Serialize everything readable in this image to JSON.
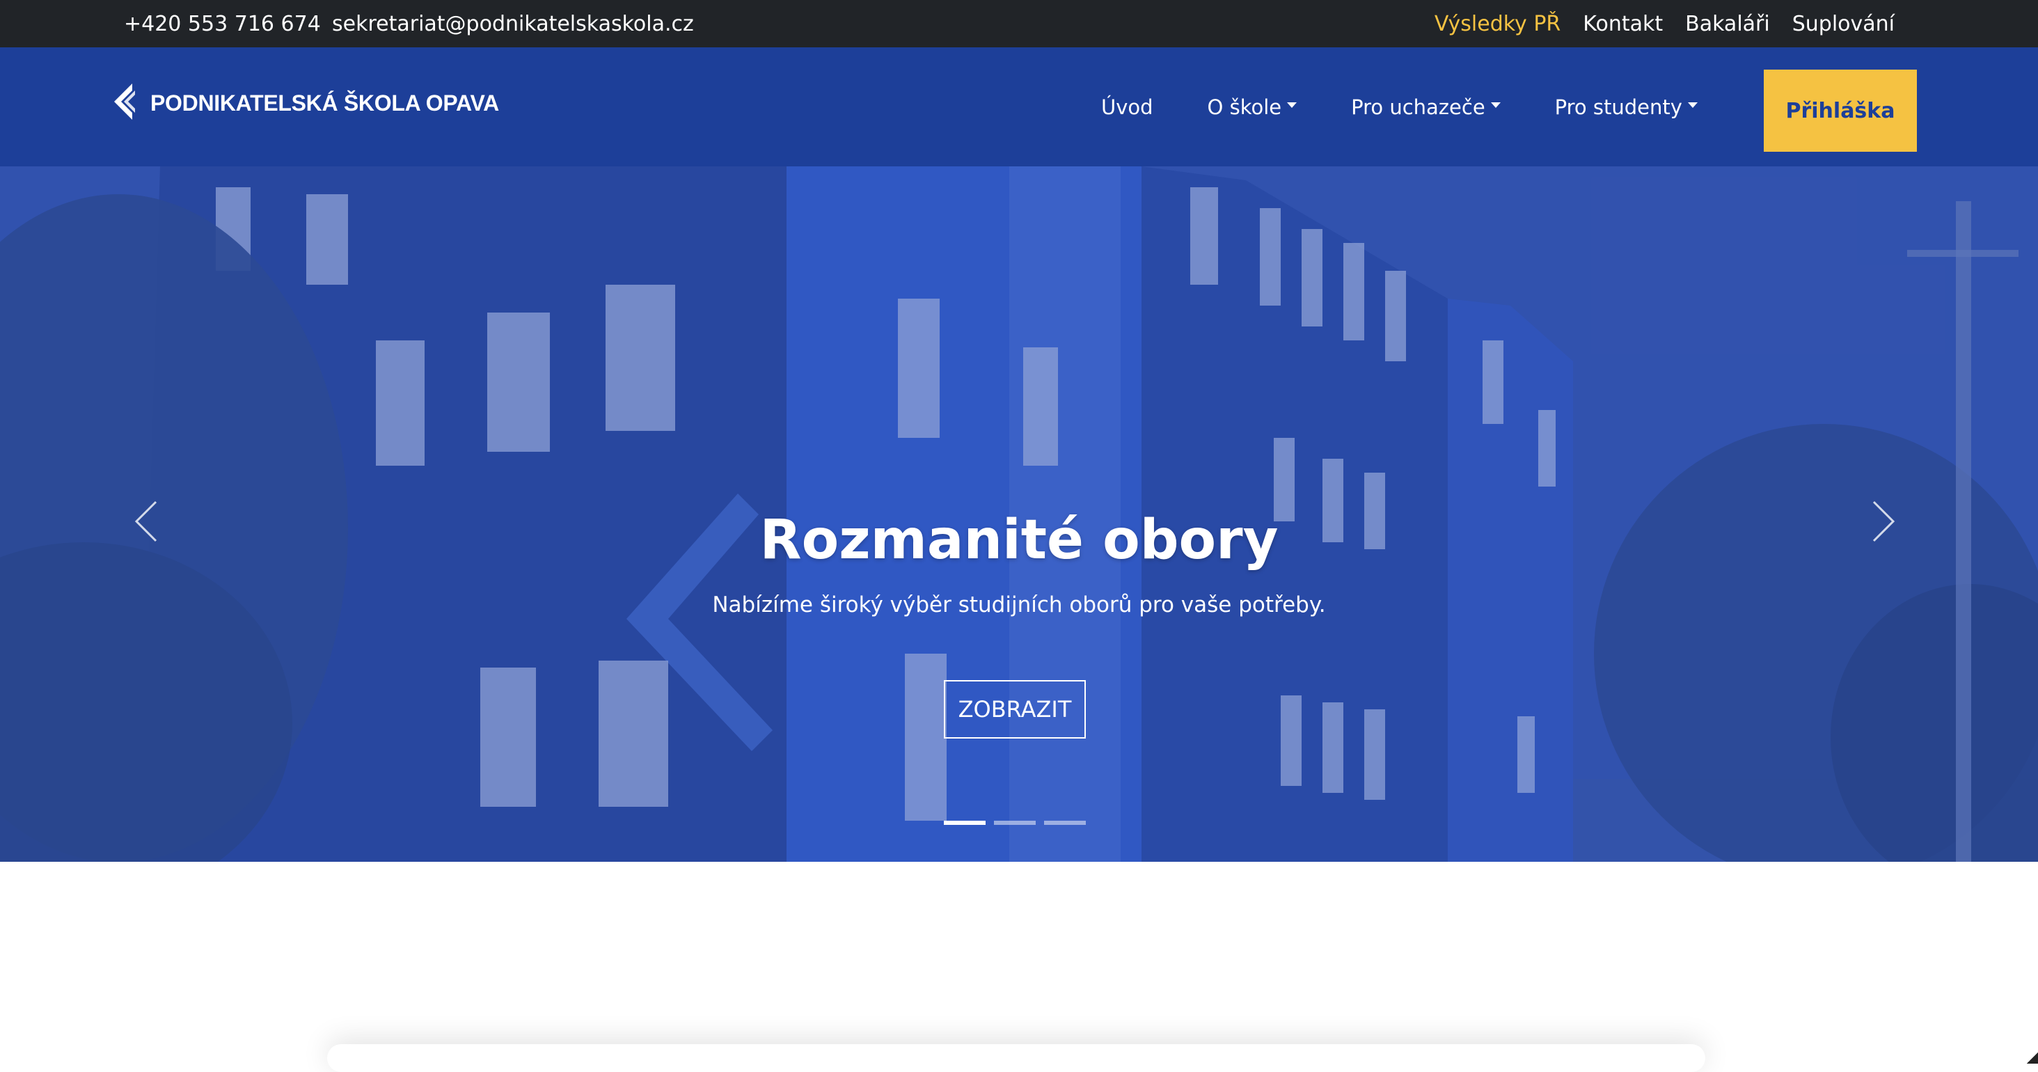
{
  "topbar": {
    "phone": "+420 553 716 674",
    "email": "sekretariat@podnikatelskaskola.cz",
    "links": [
      {
        "label": "Výsledky PŘ",
        "highlight": true
      },
      {
        "label": "Kontakt"
      },
      {
        "label": "Bakaláři"
      },
      {
        "label": "Suplování"
      }
    ]
  },
  "navbar": {
    "logo_text": "PODNIKATELSKÁ ŠKOLA OPAVA",
    "items": [
      {
        "label": "Úvod",
        "dropdown": false
      },
      {
        "label": "O škole",
        "dropdown": true
      },
      {
        "label": "Pro uchazeče",
        "dropdown": true
      },
      {
        "label": "Pro studenty",
        "dropdown": true
      }
    ],
    "apply_label": "Přihláška"
  },
  "hero": {
    "title": "Rozmanité obory",
    "subtitle": "Nabízíme široký výběr studijních oborů pro vaše potřeby.",
    "cta_label": "ZOBRAZIT",
    "slide_count": 3,
    "active_slide": 1
  },
  "colors": {
    "topbar_bg": "#212428",
    "navbar_bg": "#1d3f99",
    "accent": "#f5c242",
    "hero_overlay": "#2f4fa6"
  },
  "icons": {
    "logo": "diamond-arrow-logo-icon",
    "prev": "chevron-left-icon",
    "next": "chevron-right-icon",
    "dropdown": "caret-down-icon"
  }
}
